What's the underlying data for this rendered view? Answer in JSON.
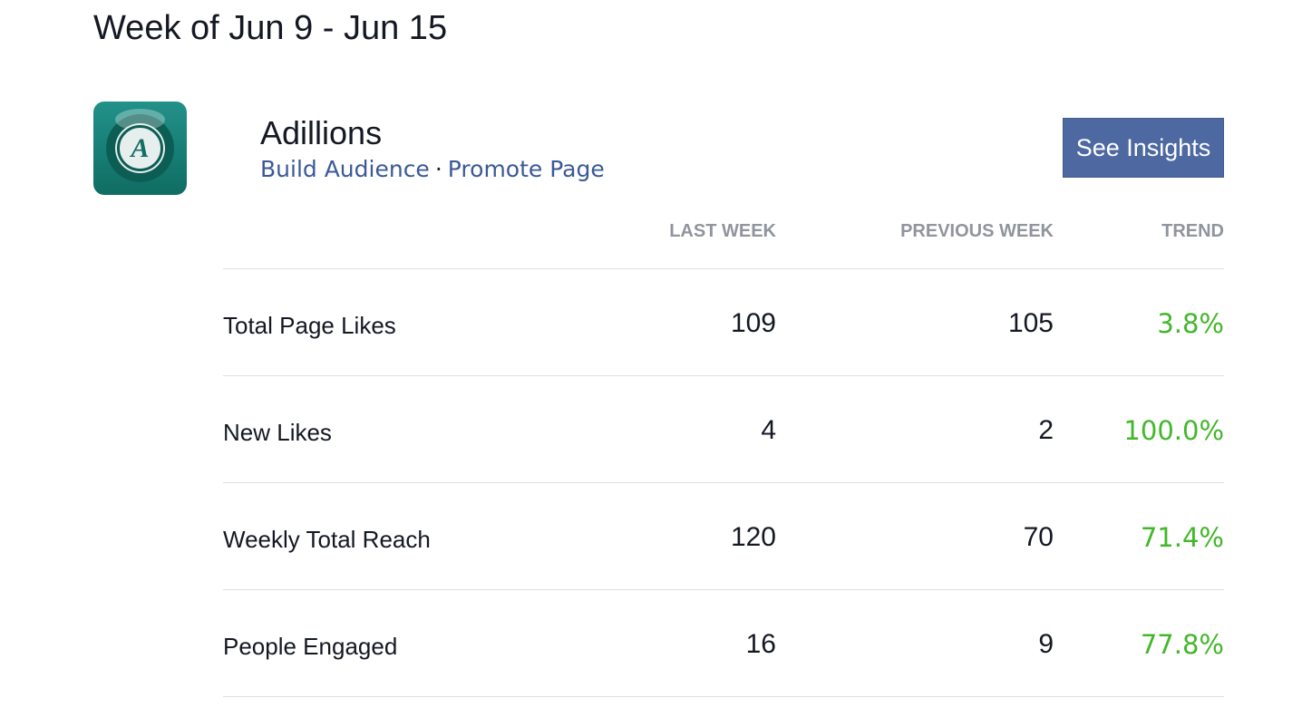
{
  "title": "Week of Jun 9 - Jun 15",
  "page": {
    "name": "Adillions",
    "logo_letter": "A",
    "links": [
      "Build Audience",
      "Promote Page"
    ],
    "separator": "·"
  },
  "button": "See Insights",
  "columns": [
    "LAST WEEK",
    "PREVIOUS WEEK",
    "TREND"
  ],
  "rows": [
    {
      "label": "Total Page Likes",
      "last": "109",
      "prev": "105",
      "trend": "3.8%"
    },
    {
      "label": "New Likes",
      "last": "4",
      "prev": "2",
      "trend": "100.0%"
    },
    {
      "label": "Weekly Total Reach",
      "last": "120",
      "prev": "70",
      "trend": "71.4%"
    },
    {
      "label": "People Engaged",
      "last": "16",
      "prev": "9",
      "trend": "77.8%"
    }
  ],
  "colors": {
    "link": "#3b5998",
    "button": "#4e69a2",
    "trend": "#42b72a"
  }
}
